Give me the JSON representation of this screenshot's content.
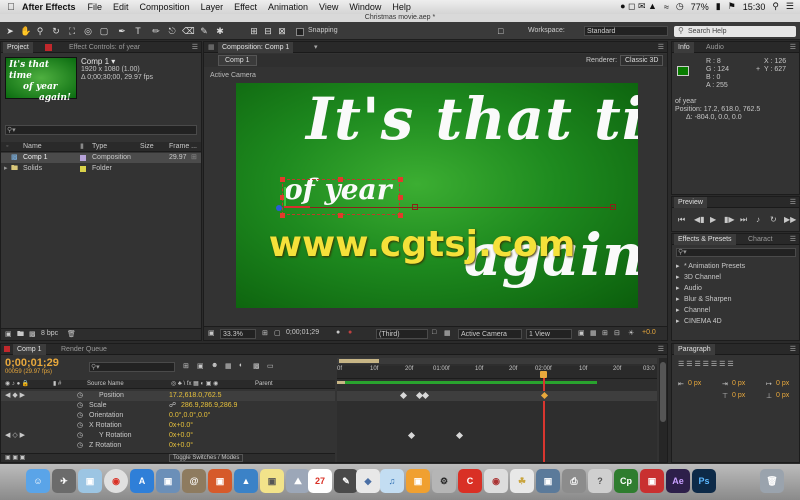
{
  "menubar": {
    "app": "After Effects",
    "menus": [
      "File",
      "Edit",
      "Composition",
      "Layer",
      "Effect",
      "Animation",
      "View",
      "Window",
      "Help"
    ],
    "battery": "77%",
    "clock": "15:30"
  },
  "window": {
    "title": "Christmas movie.aep *"
  },
  "toolbar": {
    "snapping": "Snapping",
    "workspace_label": "Workspace:",
    "workspace_value": "Standard",
    "search_placeholder": "Search Help"
  },
  "project": {
    "tab_project": "Project",
    "tab_effect_controls": "Effect Controls: of year",
    "item_name": "Comp 1 ▾",
    "item_size": "1920 x 1080 (1.00)",
    "item_duration": "Δ 0;00;30;00, 29.97 fps",
    "thumb_lines": [
      "It's that time",
      "of year",
      "again!"
    ],
    "columns": [
      "Name",
      "Type",
      "Size",
      "Frame ..."
    ],
    "items": [
      {
        "name": "Comp 1",
        "type": "Composition",
        "size": "",
        "frame": "29.97"
      },
      {
        "name": "Solids",
        "type": "Folder",
        "size": "",
        "frame": ""
      }
    ],
    "bpc": "8 bpc"
  },
  "composition": {
    "tab": "Composition: Comp 1",
    "subtab": "Comp 1",
    "renderer_label": "Renderer:",
    "renderer_value": "Classic 3D",
    "active_camera": "Active Camera",
    "canvas_lines": [
      "It's that tim",
      "of year",
      "again!"
    ],
    "footer": {
      "zoom": "33.3%",
      "timecode": "0;00;01;29",
      "resolution": "(Third)",
      "view": "Active Camera",
      "views": "1 View",
      "exposure": "+0.0"
    }
  },
  "watermark": "www.cgtsj.com",
  "info": {
    "tab_info": "Info",
    "tab_audio": "Audio",
    "rgba": [
      "R : 8",
      "G : 124",
      "B : 0",
      "A : 255"
    ],
    "xy": [
      "X : 126",
      "Y : 627"
    ],
    "layer": "of year",
    "position": "Position: 17.2, 618.0, 762.5",
    "delta": "Δ: -804.0, 0.0, 0.0",
    "swatch_color": "#087c00"
  },
  "preview": {
    "tab": "Preview"
  },
  "effects": {
    "tab": "Effects & Presets",
    "tab2": "Charact",
    "items": [
      "* Animation Presets",
      "3D Channel",
      "Audio",
      "Blur & Sharpen",
      "Channel",
      "CINEMA 4D"
    ]
  },
  "paragraph": {
    "tab": "Paragraph",
    "fields": [
      "0 px",
      "0 px",
      "0 px",
      "0 px",
      "0 px"
    ]
  },
  "timeline": {
    "tab_comp": "Comp 1",
    "tab_render": "Render Queue",
    "timecode": "0;00;01;29",
    "frames": "00059 (29.97 fps)",
    "col_source": "Source Name",
    "col_parent": "Parent",
    "ruler": [
      "0f",
      "10f",
      "20f",
      "01:00f",
      "10f",
      "20f",
      "02:00f",
      "10f",
      "20f",
      "03:0"
    ],
    "properties": [
      {
        "name": "Position",
        "value": "17.2,618.0,762.5"
      },
      {
        "name": "Scale",
        "value": "286.9,286.9,286.9"
      },
      {
        "name": "Orientation",
        "value": "0.0°,0.0°,0.0°"
      },
      {
        "name": "X Rotation",
        "value": "0x+0.0°"
      },
      {
        "name": "Y Rotation",
        "value": "0x+0.0°"
      },
      {
        "name": "Z Rotation",
        "value": "0x+0.0°"
      }
    ],
    "toggle": "Toggle Switches / Modes"
  },
  "dock": {
    "apps": [
      "Finder",
      "Launchpad",
      "Chrome",
      "Safari",
      "Mail",
      "Contacts",
      "Calendar",
      "Notes",
      "Reminders",
      "Maps",
      "Photos",
      "Messages",
      "FaceTime",
      "iTunes",
      "iBooks",
      "App Store",
      "System Preferences",
      "Unity",
      "Cinema",
      "Premiere",
      "After Effects",
      "Photoshop",
      "Trash"
    ],
    "labels": {
      "cp": "Cp",
      "ae": "Ae",
      "ps": "Ps",
      "cal": "27"
    }
  }
}
